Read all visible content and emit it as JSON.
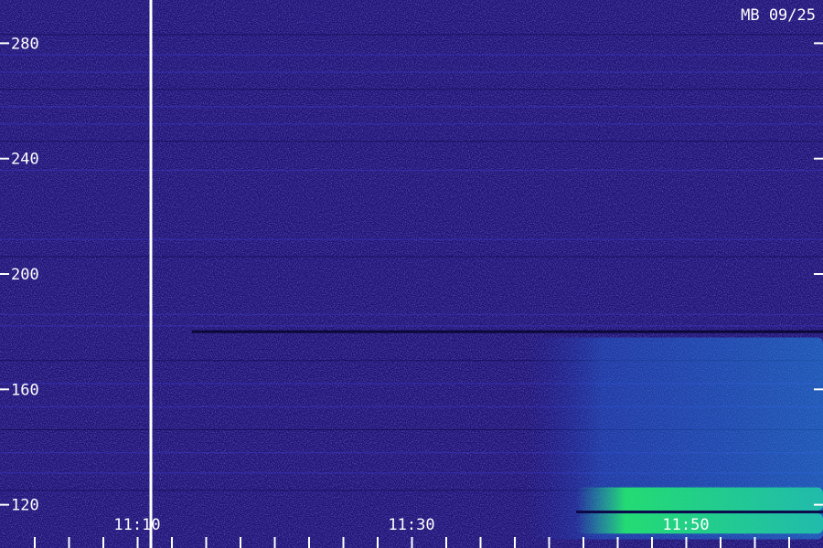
{
  "chart_data": {
    "type": "heatmap",
    "station_label": "MB 09/25",
    "y_axis": {
      "ticks": [
        120,
        160,
        200,
        240,
        280
      ],
      "tick_labels": [
        "120",
        "160",
        "200",
        "240",
        "280"
      ],
      "range": [
        105,
        295
      ]
    },
    "x_axis": {
      "labeled_times": [
        "11:10",
        "11:30",
        "11:50"
      ],
      "range_minutes": [
        0,
        60
      ],
      "labeled_minutes": [
        10,
        30,
        50
      ],
      "minor_tick_step_minutes": 2.5
    },
    "marker_line_minute": 11,
    "emission_regions": [
      {
        "t_start": 38.5,
        "t_end": 60,
        "f_low": 108,
        "f_high": 178,
        "intensity": 0.55
      },
      {
        "t_start": 42,
        "t_end": 60,
        "f_low": 118,
        "f_high": 126,
        "intensity": 1.0
      },
      {
        "t_start": 42,
        "t_end": 60,
        "f_low": 110,
        "f_high": 117,
        "intensity": 0.85
      }
    ],
    "colors": {
      "background": "#1b0f70",
      "low": "#2a1aa8",
      "mid": "#1f6fe0",
      "high": "#22ff66",
      "marker": "#ffffff",
      "text": "#ffffff"
    }
  }
}
